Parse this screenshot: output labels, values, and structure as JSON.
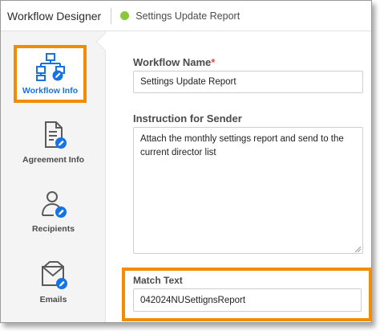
{
  "header": {
    "app_title": "Workflow Designer",
    "document_title": "Settings Update Report",
    "status_color": "#8cc63f"
  },
  "sidebar": {
    "items": [
      {
        "label": "Workflow Info",
        "icon": "workflow-diagram-icon",
        "active": true
      },
      {
        "label": "Agreement Info",
        "icon": "document-edit-icon",
        "active": false
      },
      {
        "label": "Recipients",
        "icon": "person-edit-icon",
        "active": false
      },
      {
        "label": "Emails",
        "icon": "email-edit-icon",
        "active": false
      }
    ]
  },
  "form": {
    "workflow_name_label": "Workflow Name",
    "required_marker": "*",
    "workflow_name_value": "Settings Update Report",
    "instruction_label": "Instruction for Sender",
    "instruction_value": "Attach the monthly settings report and send to the current director list",
    "match_text_label": "Match Text",
    "match_text_value": "042024NUSettignsReport"
  },
  "colors": {
    "accent": "#1473e6",
    "highlight": "#f28c00",
    "required": "#e34850"
  }
}
